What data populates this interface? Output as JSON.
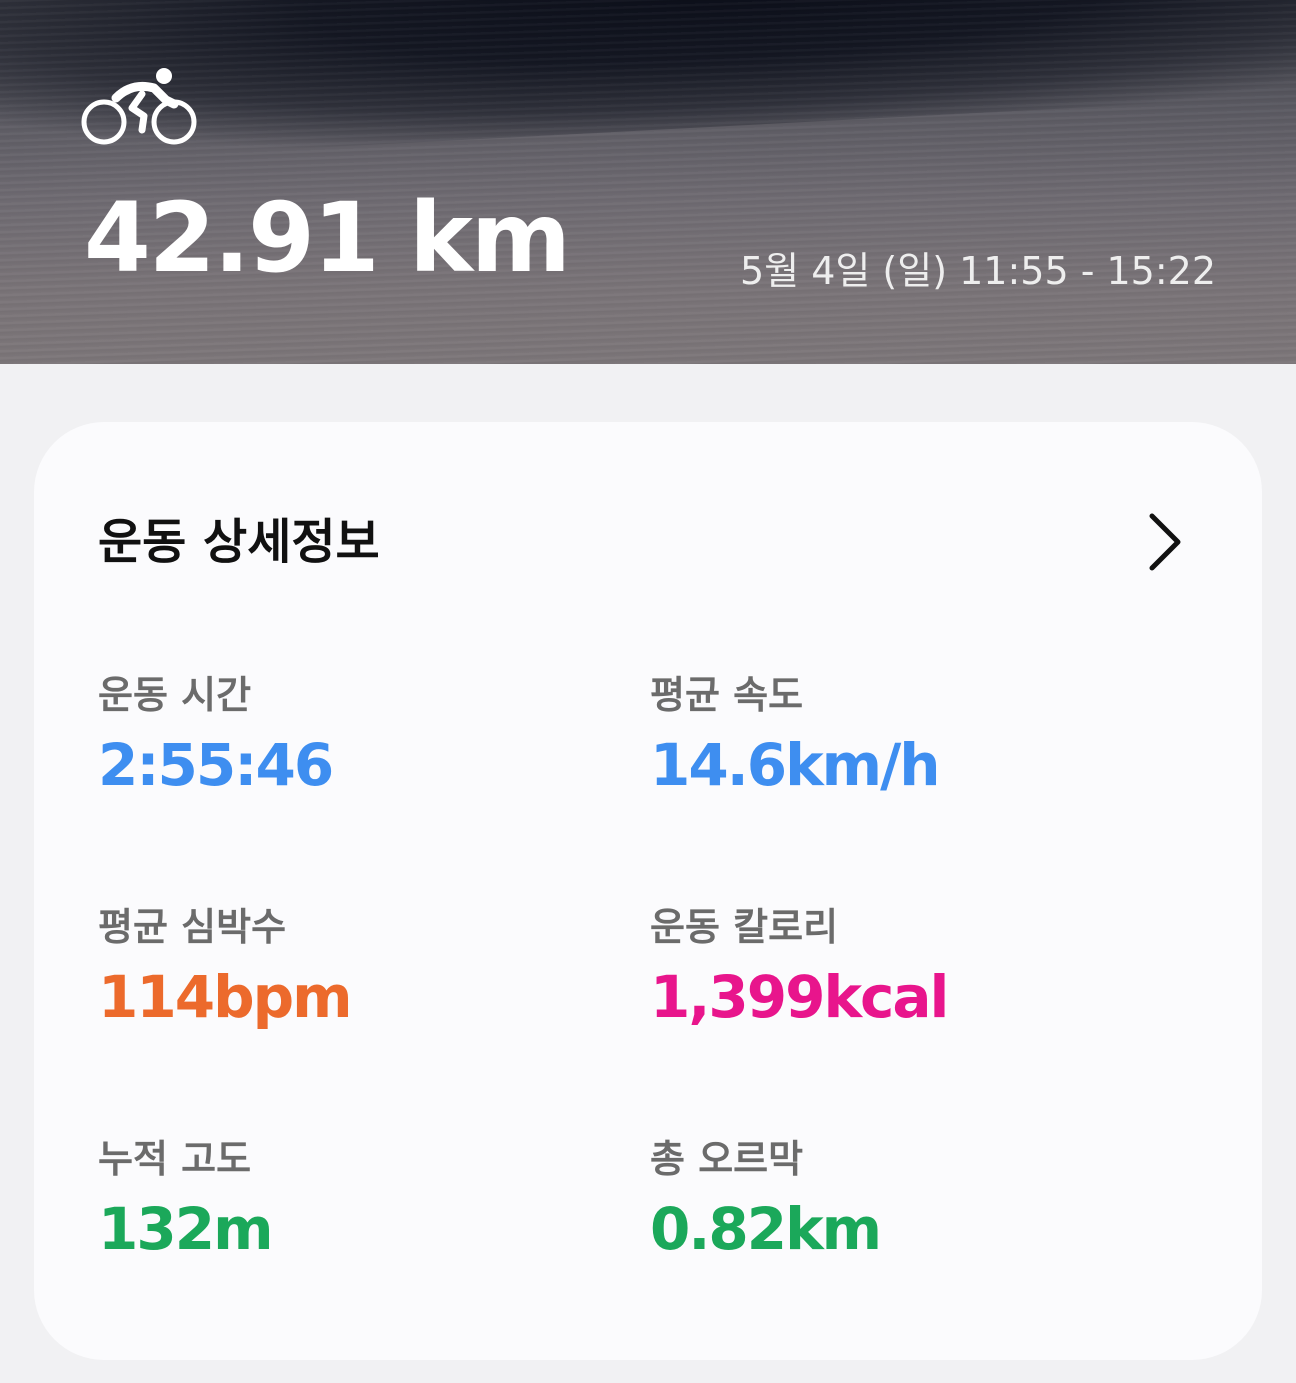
{
  "header": {
    "activity_icon": "bike-icon",
    "distance": "42.91 km",
    "datetime": "5월 4일 (일) 11:55 - 15:22"
  },
  "details": {
    "title": "운동 상세정보",
    "more_icon": "chevron-right-icon",
    "stats": {
      "duration": {
        "label": "운동 시간",
        "value": "2:55:46",
        "color": "#3e8ef0"
      },
      "avg_speed": {
        "label": "평균 속도",
        "value": "14.6km/h",
        "color": "#3e8ef0"
      },
      "avg_hr": {
        "label": "평균 심박수",
        "value": "114bpm",
        "color": "#ec6a2c"
      },
      "calories": {
        "label": "운동 칼로리",
        "value": "1,399kcal",
        "color": "#e8158c"
      },
      "elevation": {
        "label": "누적 고도",
        "value": "132m",
        "color": "#1ba85a"
      },
      "total_ascent": {
        "label": "총 오르막",
        "value": "0.82km",
        "color": "#1ba85a"
      }
    }
  }
}
